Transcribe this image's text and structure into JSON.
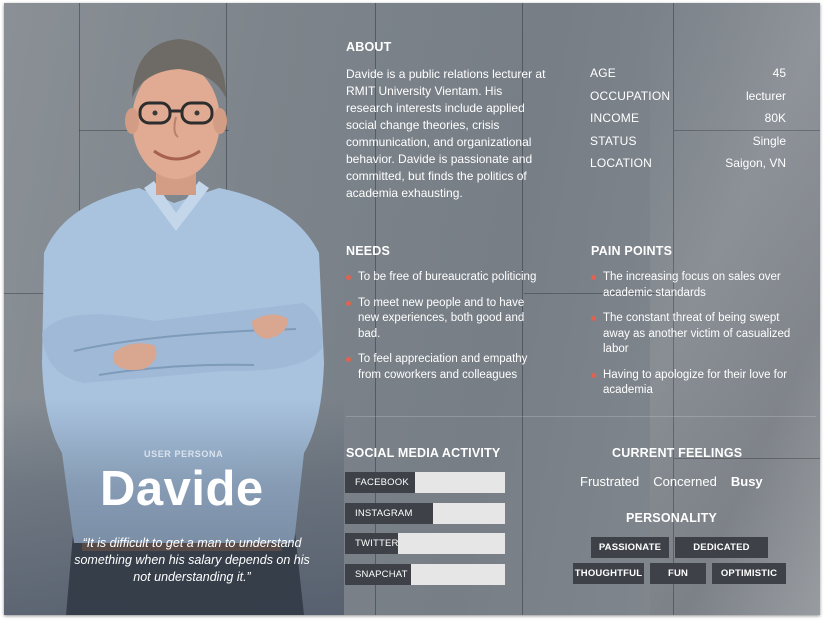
{
  "persona": {
    "tag": "USER PERSONA",
    "name": "Davide",
    "quote": "“It is difficult to get a man to understand something when his salary depends on his not understanding it.”"
  },
  "about": {
    "heading": "ABOUT",
    "text": "Davide is a public relations lecturer at RMIT University Vientam.  His research interests include applied social change theories, crisis communication, and organizational behavior. Davide is passionate and committed, but finds the politics of academia exhausting."
  },
  "stats": [
    {
      "key": "AGE",
      "value": "45"
    },
    {
      "key": "OCCUPATION",
      "value": "lecturer"
    },
    {
      "key": "INCOME",
      "value": "80K"
    },
    {
      "key": "STATUS",
      "value": "Single"
    },
    {
      "key": "LOCATION",
      "value": "Saigon, VN"
    }
  ],
  "needs": {
    "heading": "NEEDS",
    "items": [
      "To be free of bureaucratic politicing",
      "To meet new people and to have new experiences, both good and bad.",
      "To feel appreciation and empathy from coworkers and colleagues"
    ]
  },
  "pain_points": {
    "heading": "PAIN POINTS",
    "items": [
      "The increasing focus on sales over academic standards",
      "The constant threat of being swept away as another victim of casualized labor",
      "Having to apologize for their love for academia"
    ]
  },
  "social_media": {
    "heading": "SOCIAL MEDIA ACTIVITY",
    "items": [
      {
        "label": "FACEBOOK",
        "level": 0.44
      },
      {
        "label": "INSTAGRAM",
        "level": 0.55
      },
      {
        "label": "TWITTER",
        "level": 0.33
      },
      {
        "label": "SNAPCHAT",
        "level": 0.41
      }
    ]
  },
  "feelings": {
    "heading": "CURRENT FEELINGS",
    "items": [
      "Frustrated",
      "Concerned",
      "Busy"
    ]
  },
  "personality": {
    "heading": "PERSONALITY",
    "tags": [
      "PASSIONATE",
      "DEDICATED",
      "THOUGHTFUL",
      "FUN",
      "OPTIMISTIC"
    ]
  },
  "colors": {
    "bullet": "#e0624f",
    "bar_fill": "#3e4248",
    "bar_track": "#e6e6e6"
  }
}
